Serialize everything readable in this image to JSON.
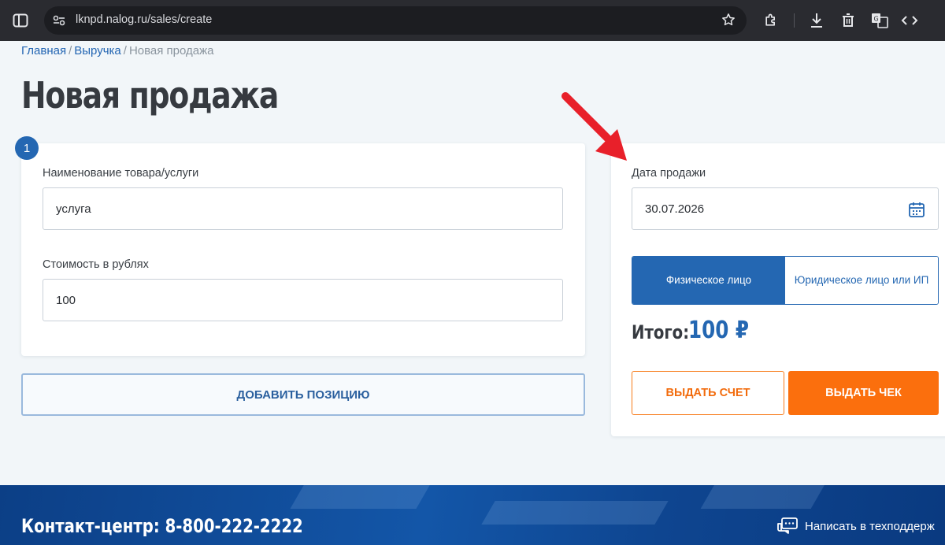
{
  "browser": {
    "url": "lknpd.nalog.ru/sales/create"
  },
  "breadcrumb": {
    "items": [
      "Главная",
      "Выручка"
    ],
    "separator": "/",
    "current": "Новая продажа"
  },
  "page": {
    "title": "Новая продажа"
  },
  "position_card": {
    "step": "1",
    "name_label": "Наименование товара/услуги",
    "name_value": "услуга",
    "price_label": "Стоимость в рублях",
    "price_value": "100"
  },
  "add_position_label": "ДОБАВИТЬ ПОЗИЦИЮ",
  "sale_card": {
    "date_label": "Дата продажи",
    "date_value": "30.07.2026",
    "buyer_types": [
      "Физическое лицо",
      "Юридическое лицо или ИП"
    ],
    "selected_buyer_type": "Физическое лицо",
    "total_label": "Итого:",
    "total_value": "100 ₽",
    "invoice_button": "ВЫДАТЬ СЧЕТ",
    "receipt_button": "ВЫДАТЬ ЧЕК"
  },
  "footer": {
    "contact": "Контакт-центр: 8-800-222-2222",
    "support_link": "Написать в техподдерж"
  },
  "colors": {
    "brand_blue": "#2467b2",
    "accent_orange": "#fb6f0d",
    "annotation_red": "#e8202a",
    "footer_blue": "#1356a8"
  },
  "icons": {
    "sidebar": "sidebar-toggle-icon",
    "site_info": "site-info-icon",
    "bookmark": "star-icon",
    "extensions": "puzzle-icon",
    "downloads": "download-icon",
    "delete": "trash-icon",
    "translate": "translate-icon",
    "devtools": "code-icon",
    "calendar": "calendar-icon",
    "chat": "chat-icon",
    "annotation": "red-arrow-icon"
  }
}
